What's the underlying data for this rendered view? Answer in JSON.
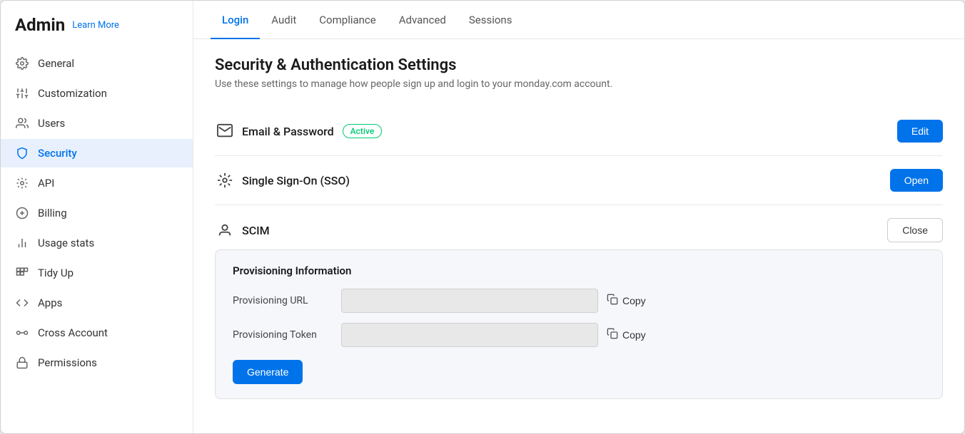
{
  "sidebar": {
    "title": "Admin",
    "learn_more": "Learn More",
    "items": [
      {
        "id": "general",
        "label": "General",
        "icon": "⚙"
      },
      {
        "id": "customization",
        "label": "Customization",
        "icon": "⚡"
      },
      {
        "id": "users",
        "label": "Users",
        "icon": "👤"
      },
      {
        "id": "security",
        "label": "Security",
        "icon": "🛡"
      },
      {
        "id": "api",
        "label": "API",
        "icon": "⚙"
      },
      {
        "id": "billing",
        "label": "Billing",
        "icon": "💰"
      },
      {
        "id": "usage-stats",
        "label": "Usage stats",
        "icon": "📊"
      },
      {
        "id": "tidy-up",
        "label": "Tidy Up",
        "icon": "🗂"
      },
      {
        "id": "apps",
        "label": "Apps",
        "icon": "⟨/⟩"
      },
      {
        "id": "cross-account",
        "label": "Cross Account",
        "icon": "⚡"
      },
      {
        "id": "permissions",
        "label": "Permissions",
        "icon": "🔒"
      }
    ]
  },
  "tabs": [
    {
      "id": "login",
      "label": "Login",
      "active": true
    },
    {
      "id": "audit",
      "label": "Audit"
    },
    {
      "id": "compliance",
      "label": "Compliance"
    },
    {
      "id": "advanced",
      "label": "Advanced"
    },
    {
      "id": "sessions",
      "label": "Sessions"
    }
  ],
  "page": {
    "title": "Security & Authentication Settings",
    "subtitle": "Use these settings to manage how people sign up and login to your monday.com account."
  },
  "settings": {
    "email_password": {
      "label": "Email & Password",
      "badge": "Active",
      "edit_btn": "Edit"
    },
    "sso": {
      "label": "Single Sign-On (SSO)",
      "open_btn": "Open"
    },
    "scim": {
      "label": "SCIM",
      "close_btn": "Close",
      "expand": {
        "title": "Provisioning Information",
        "url_label": "Provisioning URL",
        "token_label": "Provisioning Token",
        "copy_label": "Copy",
        "generate_btn": "Generate"
      }
    }
  }
}
